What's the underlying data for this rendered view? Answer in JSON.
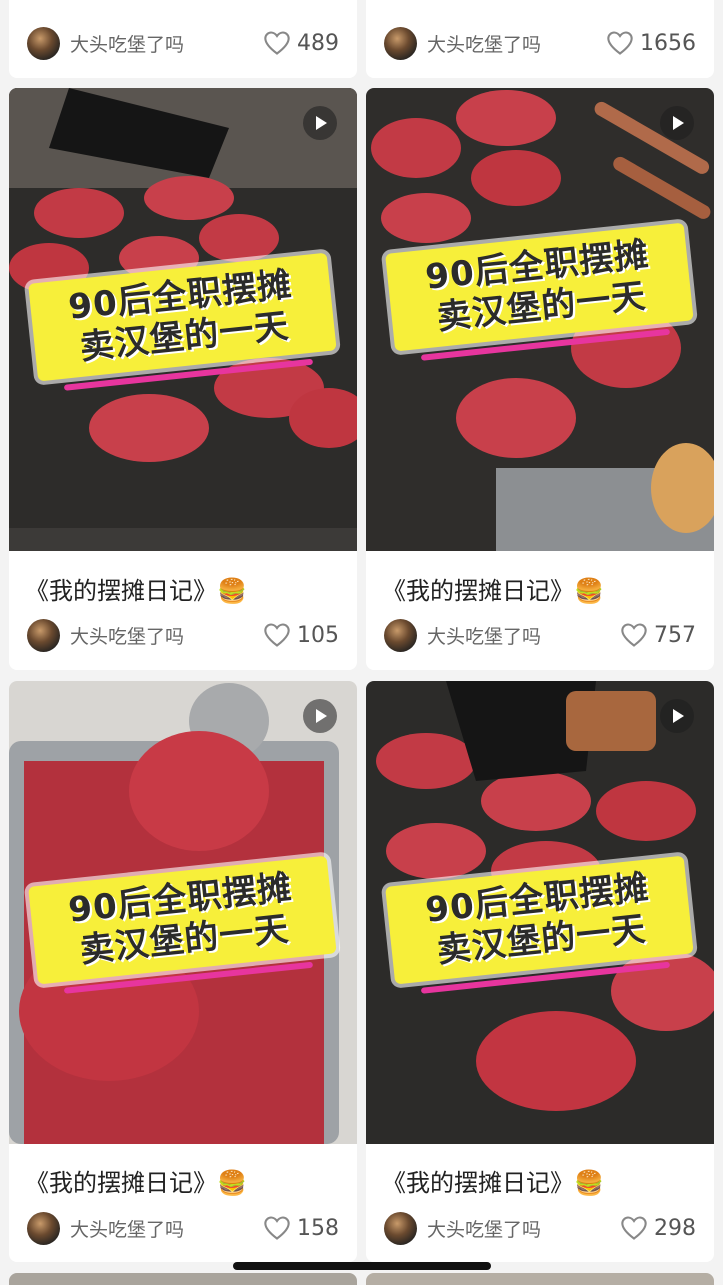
{
  "feed": {
    "top_row": [
      {
        "author": "大头吃堡了吗",
        "likes": "489"
      },
      {
        "author": "大头吃堡了吗",
        "likes": "1656"
      }
    ],
    "cards": [
      {
        "overlay_line1": "90后全职摆摊",
        "overlay_line2": "卖汉堡的一天",
        "title": "《我的摆摊日记》🍔",
        "author": "大头吃堡了吗",
        "likes": "105"
      },
      {
        "overlay_line1": "90后全职摆摊",
        "overlay_line2": "卖汉堡的一天",
        "title": "《我的摆摊日记》🍔",
        "author": "大头吃堡了吗",
        "likes": "757"
      },
      {
        "overlay_line1": "90后全职摆摊",
        "overlay_line2": "卖汉堡的一天",
        "title": "《我的摆摊日记》🍔",
        "author": "大头吃堡了吗",
        "likes": "158"
      },
      {
        "overlay_line1": "90后全职摆摊",
        "overlay_line2": "卖汉堡的一天",
        "title": "《我的摆摊日记》🍔",
        "author": "大头吃堡了吗",
        "likes": "298"
      }
    ]
  },
  "icons": {
    "play": "play-icon",
    "like": "heart-icon",
    "avatar": "avatar"
  },
  "colors": {
    "overlay_bg": "#f7ef3a",
    "overlay_underline": "#e7359e",
    "background": "#f3f3f3"
  }
}
